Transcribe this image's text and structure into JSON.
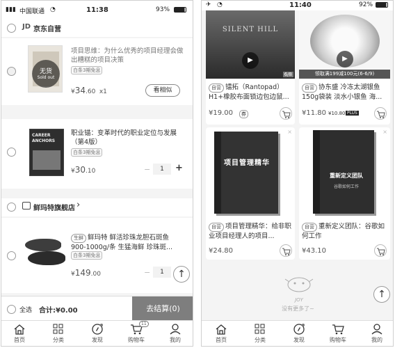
{
  "left": {
    "status": {
      "carrier": "中国联通",
      "time": "11:38",
      "battery": "93%"
    },
    "jd_store": {
      "logo": "JD",
      "name": "京东自营"
    },
    "item1": {
      "cover_sold": "无货",
      "cover_sold_en": "Sold out",
      "title": "项目思维：为什么优秀的项目经理会做出糟糕的项目决策",
      "tag": "白条3期免息",
      "currency": "¥",
      "price_int": "34",
      "price_dec": ".60",
      "qty": "x1",
      "similar_button": "看相似"
    },
    "item2": {
      "cover_title": "CAREER ANCHORS",
      "title": "职业锚：变革时代的职业定位与发展（第4版）",
      "tag": "白条3期免息",
      "currency": "¥",
      "price_int": "30",
      "price_dec": ".10",
      "minus": "−",
      "qty": "1",
      "plus": "+"
    },
    "store2": {
      "name": "鲜玛特旗舰店",
      "chevron": "›"
    },
    "item3": {
      "badge": "生鲜",
      "title": "鲜玛特 鲜活珍珠龙胆石斑鱼 900-1000g/条 生猛海鲜 珍珠斑...",
      "tag": "白条3期免息",
      "currency": "¥",
      "price_int": "149",
      "price_dec": ".00",
      "minus": "−",
      "qty": "1"
    },
    "bottom": {
      "select_all": "全选",
      "total": "合计:¥0.00",
      "checkout": "去结算(0)"
    },
    "tabs": [
      "首页",
      "分类",
      "发现",
      "购物车",
      "我的"
    ],
    "cart_badge": "11",
    "top_arrow": "↑"
  },
  "right": {
    "status": {
      "time": "11:40",
      "battery": "92%"
    },
    "product1": {
      "cover_text": "SILENT HILL",
      "counter": "6/8",
      "badge": "自营",
      "title": "镭拓（Rantopad）H1+橡胶布面锁边包边鼠...",
      "price": "¥19.00"
    },
    "product2": {
      "promo": "领取满199减100元(6-6/9)",
      "badge": "自营",
      "title": "协东盛 冷冻太湖银鱼 150g袋装 淡水小银鱼 海...",
      "price": "¥11.80",
      "plus_price": "¥10.80",
      "plus_label": "PLUS"
    },
    "product3": {
      "cover_title": "项目管理精华",
      "badge": "自营",
      "title": "项目管理精华：给非职业项目经理人的项目...",
      "price": "¥24.80"
    },
    "product4": {
      "cover_title": "重新定义团队",
      "cover_sub": "谷歌如何工作",
      "badge": "自营",
      "title": "重新定义团队：谷歌如何工作",
      "price": "¥43.10"
    },
    "footer": {
      "logo": "JOY",
      "text": "没有更多了~"
    },
    "tabs": [
      "首页",
      "分类",
      "发现",
      "购物车",
      "我的"
    ],
    "top_arrow": "↑"
  }
}
